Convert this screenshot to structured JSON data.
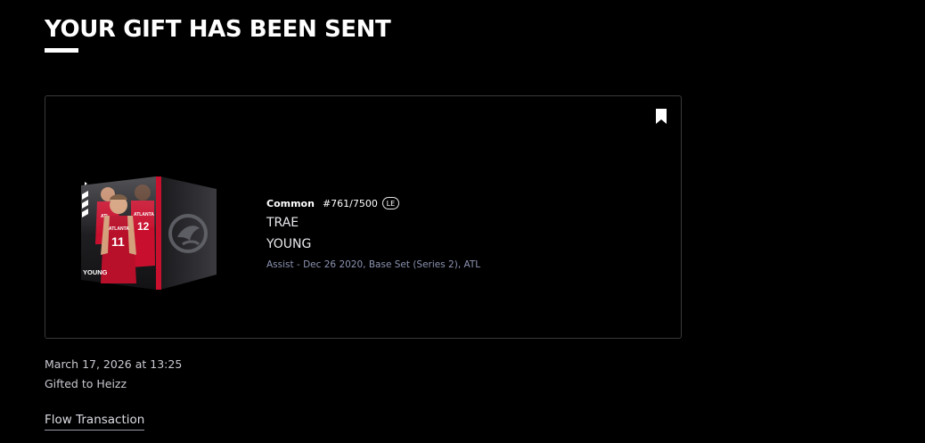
{
  "header": {
    "title": "YOUR GIFT HAS BEEN SENT"
  },
  "moment": {
    "tier": "Common",
    "serial": "#761/7500",
    "badge": "LE",
    "first_name": "TRAE",
    "last_name": "YOUNG",
    "details": "Assist - Dec 26 2020, Base Set (Series 2), ATL",
    "card_art": {
      "jersey_text": "ATLANTA",
      "jersey_number": "11",
      "teammate_number": "12",
      "nameplate": "YOUNG",
      "team_logo": "hawks-logo-icon",
      "team_colors": {
        "red": "#c8102e",
        "dark": "#1e1e22"
      }
    },
    "bookmark_icon": "bookmark-icon"
  },
  "transaction": {
    "date": "March 17, 2026 at 13:25",
    "recipient": "Gifted to Heizz",
    "link_label": "Flow Transaction"
  }
}
